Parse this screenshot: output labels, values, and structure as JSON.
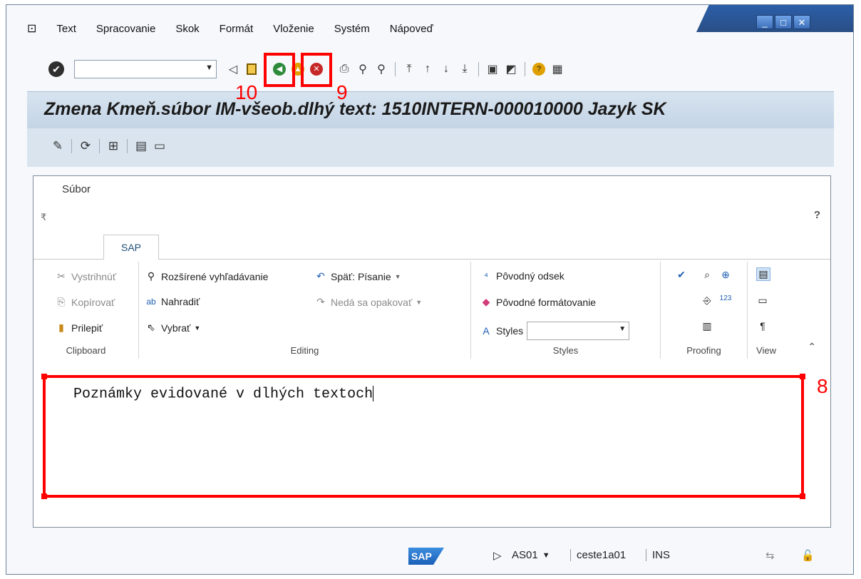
{
  "window": {
    "controls": [
      "_",
      "□",
      "✕"
    ]
  },
  "menu": [
    "Text",
    "Spracovanie",
    "Skok",
    "Formát",
    "Vloženie",
    "Systém",
    "Nápoveď"
  ],
  "command_field": {
    "value": ""
  },
  "title": "Zmena Kmeň.súbor IM-všeob.dlhý text: 1510INTERN-000010000 Jazyk SK",
  "ribbon": {
    "file_tab": "Súbor",
    "tab": "SAP",
    "help": "?",
    "clipboard": {
      "cut": "Vystrihnúť",
      "copy": "Kopírovať",
      "paste": "Prilepiť",
      "label": "Clipboard"
    },
    "editing": {
      "find": "Rozšírené vyhľadávanie",
      "replace": "Nahradiť",
      "select": "Vybrať",
      "undo": "Späť: Písanie",
      "redo": "Nedá sa opakovať",
      "label": "Editing"
    },
    "styles": {
      "orig_par": "Pôvodný odsek",
      "orig_fmt": "Pôvodné formátovanie",
      "styles": "Styles",
      "label": "Styles"
    },
    "proofing": {
      "label": "Proofing"
    },
    "view": {
      "label": "View"
    }
  },
  "document": {
    "text": "Poznámky evidované v dlhých textoch"
  },
  "annotations": {
    "a8": "8",
    "a9": "9",
    "a10": "10"
  },
  "status": {
    "system": "AS01",
    "server": "ceste1a01",
    "mode": "INS",
    "logo": "SAP"
  }
}
